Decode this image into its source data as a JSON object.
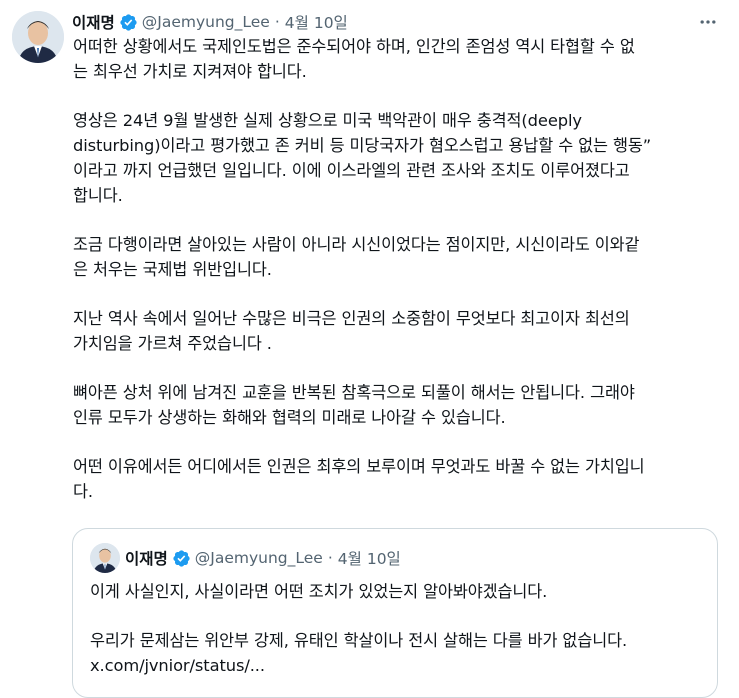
{
  "tweet": {
    "author_name": "이재명",
    "handle": "@Jaemyung_Lee",
    "separator": "·",
    "date": "4월 10일",
    "paragraphs": [
      "어떠한 상황에서도 국제인도법은 준수되어야 하며, 인간의 존엄성 역시 타협할 수 없\n는 최우선 가치로 지켜져야 합니다.",
      "영상은 24년 9월 발생한 실제 상황으로 미국 백악관이 매우 충격적(deeply\ndisturbing)이라고 평가했고 존 커비 등 미당국자가 혐오스럽고 용납할 수 없는 행동”\n이라고 까지 언급했던 일입니다. 이에 이스라엘의 관련 조사와 조치도 이루어졌다고\n합니다.",
      "조금 다행이라면 살아있는 사람이 아니라 시신이었다는 점이지만, 시신이라도 이와같\n은 처우는 국제법 위반입니다.",
      "지난 역사 속에서 일어난 수많은 비극은 인권의 소중함이 무엇보다 최고이자 최선의\n가치임을 가르쳐 주었습니다 .",
      "뼈아픈 상처 위에 남겨진 교훈을 반복된 참혹극으로 되풀이 해서는 안됩니다. 그래야\n인류 모두가 상생하는 화해와 협력의 미래로 나아갈 수 있습니다.",
      "어떤 이유에서든 어디에서든 인권은 최후의 보루이며 무엇과도 바꿀 수 없는 가치입니\n다."
    ]
  },
  "quoted_tweet": {
    "author_name": "이재명",
    "handle": "@Jaemyung_Lee",
    "separator": "·",
    "date": "4월 10일",
    "paragraphs": [
      "이게 사실인지, 사실이라면 어떤 조치가 있었는지 알아봐야겠습니다.",
      "우리가 문제삼는 위안부 강제, 유태인 학살이나 전시 살해는 다를 바가 없습니다."
    ],
    "link": "x.com/jvnior/status/..."
  },
  "icons": {
    "avatar": "profile-photo",
    "verified": "verified-badge-icon",
    "more": "more-options-icon"
  },
  "colors": {
    "text": "#0f1419",
    "secondary_text": "#536471",
    "verified_blue": "#1d9bf0",
    "quote_border": "#cfd9de"
  }
}
